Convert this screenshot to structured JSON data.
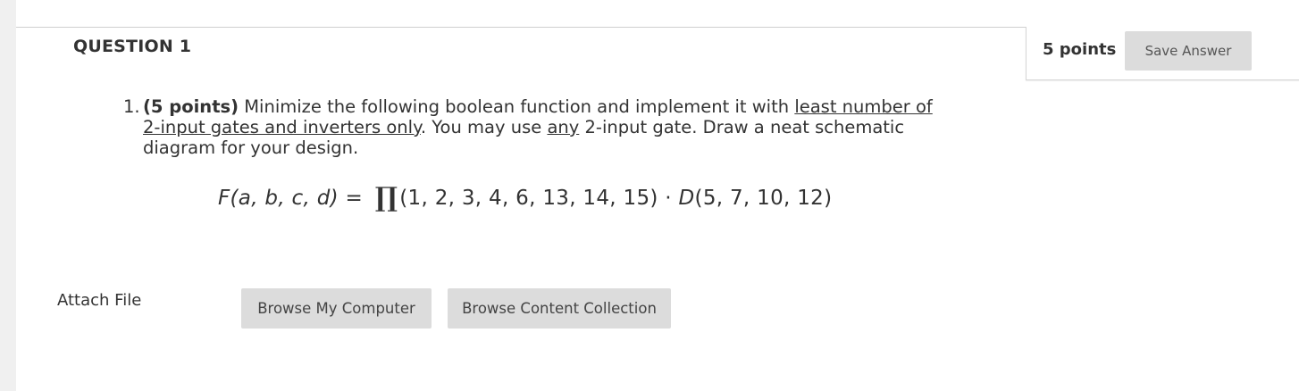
{
  "question": {
    "title": "QUESTION 1",
    "points": "5 points",
    "save_label": "Save Answer",
    "number": "1.",
    "points_inline": "(5 points)",
    "text_part1": "Minimize the following boolean function and implement it with",
    "text_underline1": "least number of 2-input gates and inverters only",
    "text_part2": ". You may use",
    "text_underline2": "any",
    "text_part3": "2-input gate. Draw a neat schematic diagram for your design.",
    "formula": {
      "lhs": "F(a, b, c, d)",
      "equals": "=",
      "product_symbol": "∏",
      "maxterms": "(1, 2, 3, 4, 6, 13, 14, 15)",
      "dot": "·",
      "dontcare_fn": "D",
      "dontcares": "(5, 7, 10, 12)"
    }
  },
  "attach": {
    "label": "Attach File",
    "browse_computer": "Browse My Computer",
    "browse_content": "Browse Content Collection"
  }
}
